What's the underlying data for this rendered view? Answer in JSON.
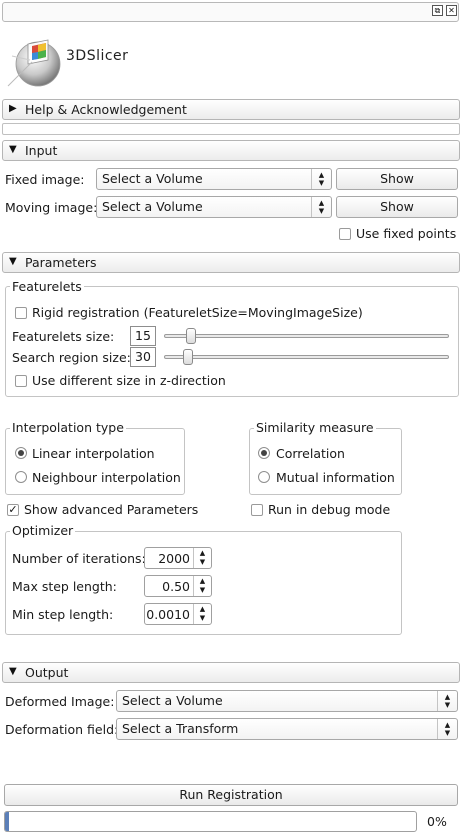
{
  "window": {
    "float_button": "⧉",
    "close_button": "✕"
  },
  "logo": {
    "text": "3DSlicer"
  },
  "sections": {
    "help": {
      "label": "Help & Acknowledgement",
      "arrow": "▶"
    },
    "input": {
      "label": "Input",
      "arrow": "▼"
    },
    "parameters": {
      "label": "Parameters",
      "arrow": "▼"
    },
    "output": {
      "label": "Output",
      "arrow": "▼"
    }
  },
  "input": {
    "fixed_image_label": "Fixed image:",
    "fixed_image_value": "Select a Volume",
    "moving_image_label": "Moving image:",
    "moving_image_value": "Select a Volume",
    "show_label": "Show",
    "use_fixed_points": {
      "label": "Use fixed points",
      "checked": false
    }
  },
  "featurelets": {
    "title": "Featurelets",
    "rigid_registration": {
      "label": "Rigid registration (FeatureletSize=MovingImageSize)",
      "checked": false
    },
    "featurelets_size": {
      "label": "Featurelets size:",
      "value": "15",
      "fraction": 0.08
    },
    "search_region_size": {
      "label": "Search region size:",
      "value": "30",
      "fraction": 0.07
    },
    "z_direction": {
      "label": "Use different size in z-direction",
      "checked": false
    }
  },
  "interpolation": {
    "title": "Interpolation type",
    "options": [
      {
        "label": "Linear interpolation",
        "selected": true
      },
      {
        "label": "Neighbour interpolation",
        "selected": false
      }
    ]
  },
  "similarity": {
    "title": "Similarity measure",
    "options": [
      {
        "label": "Correlation",
        "selected": true
      },
      {
        "label": "Mutual information",
        "selected": false
      }
    ]
  },
  "show_advanced": {
    "label": "Show advanced Parameters",
    "checked": true
  },
  "debug_mode": {
    "label": "Run in debug mode",
    "checked": false
  },
  "optimizer": {
    "title": "Optimizer",
    "iterations": {
      "label": "Number of iterations:",
      "value": "2000"
    },
    "max_step": {
      "label": "Max step length:",
      "value": "0.50"
    },
    "min_step": {
      "label": "Min step length:",
      "value": "0.0010"
    }
  },
  "output": {
    "deformed_image_label": "Deformed Image:",
    "deformed_image_value": "Select a Volume",
    "deformation_field_label": "Deformation field:",
    "deformation_field_value": "Select a Transform"
  },
  "run_button": "Run Registration",
  "progress": {
    "percent_text": "0%",
    "fraction": 0.01
  },
  "colors": {
    "progress_fill": "#5b7fb8",
    "accent": "#5b7fb8"
  }
}
